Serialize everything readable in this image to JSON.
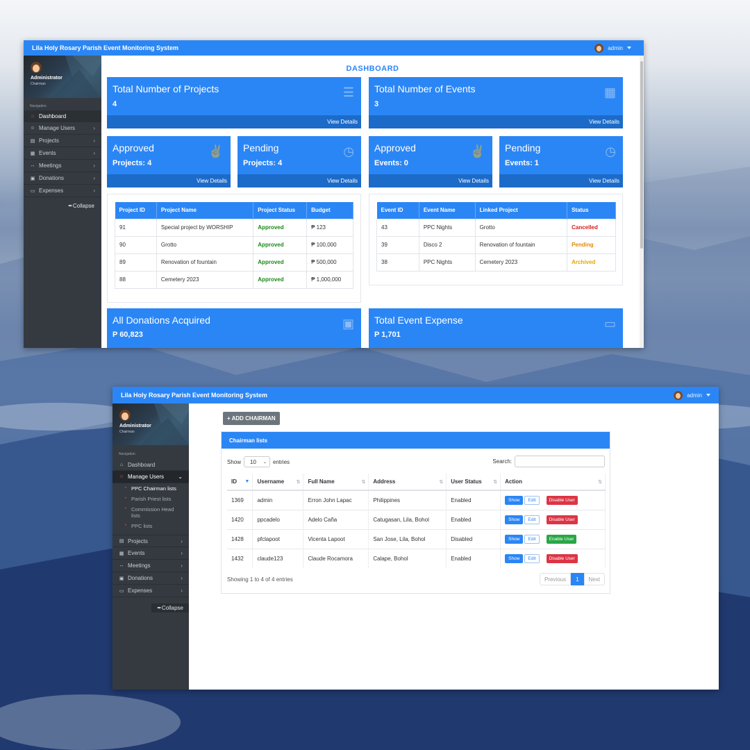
{
  "app": {
    "title": "Lila Holy Rosary Parish Event Monitoring System",
    "user_menu": "admin"
  },
  "profile": {
    "name": "Administrator",
    "role": "Chairman",
    "nav_label": "Navigation"
  },
  "nav": {
    "dashboard": "Dashboard",
    "manage_users": "Manage Users",
    "projects": "Projects",
    "events": "Events",
    "meetings": "Meetings",
    "donations": "Donations",
    "expenses": "Expenses",
    "collapse": "Collapse",
    "sub_ppc_chairman": "PPC Chairman lists",
    "sub_parish_priest": "Parish Priest lists",
    "sub_commission_head": "Commission Head lists",
    "sub_ppc": "PPC lists"
  },
  "dashboard": {
    "heading": "DASHBOARD",
    "view_details": "View Details",
    "total_projects_label": "Total Number of Projects",
    "total_projects_value": "4",
    "total_events_label": "Total Number of Events",
    "total_events_value": "3",
    "approved_projects_title": "Approved",
    "approved_projects_value": "Projects: 4",
    "pending_projects_title": "Pending",
    "pending_projects_value": "Projects: 4",
    "approved_events_title": "Approved",
    "approved_events_value": "Events: 0",
    "pending_events_title": "Pending",
    "pending_events_value": "Events: 1",
    "donations_label": "All Donations Acquired",
    "donations_value": "P 60,823",
    "expense_label": "Total Event Expense",
    "expense_value": "P 1,701",
    "projects_table": {
      "headers": [
        "Project ID",
        "Project Name",
        "Project Status",
        "Budget"
      ],
      "rows": [
        [
          "91",
          "Special project by WORSHIP",
          "Approved",
          "₱ 123"
        ],
        [
          "90",
          "Grotto",
          "Approved",
          "₱ 100,000"
        ],
        [
          "89",
          "Renovation of fountain",
          "Approved",
          "₱ 500,000"
        ],
        [
          "88",
          "Cemetery 2023",
          "Approved",
          "₱ 1,000,000"
        ]
      ]
    },
    "events_table": {
      "headers": [
        "Event ID",
        "Event Name",
        "Linked Project",
        "Status"
      ],
      "rows": [
        [
          "43",
          "PPC Nights",
          "Grotto",
          "Cancelled"
        ],
        [
          "39",
          "Disco 2",
          "Renovation of fountain",
          "Pending"
        ],
        [
          "38",
          "PPC Nights",
          "Cemetery 2023",
          "Archived"
        ]
      ]
    }
  },
  "users": {
    "add_button": "+ ADD CHAIRMAN",
    "panel_title": "Chairman lists",
    "show_label": "Show",
    "entries_value": "10",
    "entries_label": "entries",
    "search_label": "Search:",
    "headers": [
      "ID",
      "Username",
      "Full Name",
      "Address",
      "User Status",
      "Action"
    ],
    "rows": [
      {
        "id": "1369",
        "username": "admin",
        "full_name": "Erron John Lapac",
        "address": "Philippines",
        "status": "Enabled",
        "toggle": "Disable User"
      },
      {
        "id": "1420",
        "username": "ppcadelo",
        "full_name": "Adelo Caña",
        "address": "Catugasan, Lila, Bohol",
        "status": "Enabled",
        "toggle": "Disable User"
      },
      {
        "id": "1428",
        "username": "pfclapoot",
        "full_name": "Vicenta Lapoot",
        "address": "San Jose, Lila, Bohol",
        "status": "Disabled",
        "toggle": "Enable User"
      },
      {
        "id": "1432",
        "username": "claude123",
        "full_name": "Claude Rocamora",
        "address": "Calape, Bohol",
        "status": "Enabled",
        "toggle": "Disable User"
      }
    ],
    "show_btn": "Show",
    "edit_btn": "Edit",
    "showing": "Showing 1 to 4 of 4 entries",
    "prev": "Previous",
    "page": "1",
    "next": "Next"
  },
  "colors": {
    "primary": "#2b86f5",
    "sidebar": "#343a40",
    "approved": "#1a8a1a",
    "cancelled": "#d61f1f",
    "pending": "#e08a00",
    "archived": "#e0a800"
  }
}
